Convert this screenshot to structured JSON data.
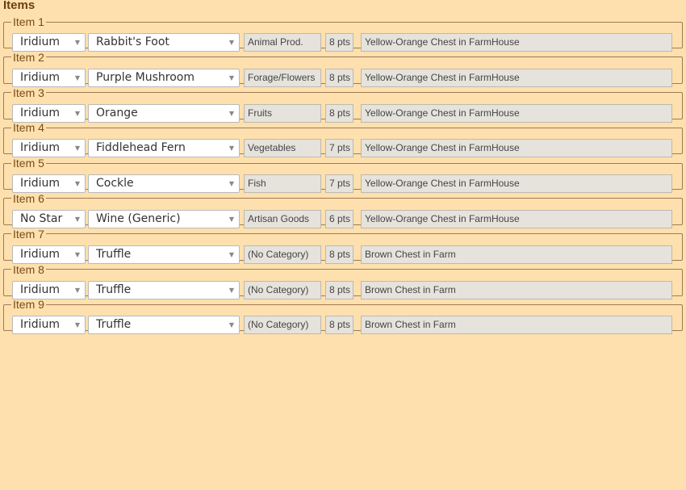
{
  "heading": "Items",
  "items": [
    {
      "label": "Item 1",
      "quality": "Iridium",
      "name": "Rabbit's Foot",
      "category": "Animal Prod.",
      "points": "8 pts",
      "location": "Yellow-Orange Chest in FarmHouse"
    },
    {
      "label": "Item 2",
      "quality": "Iridium",
      "name": "Purple Mushroom",
      "category": "Forage/Flowers",
      "points": "8 pts",
      "location": "Yellow-Orange Chest in FarmHouse"
    },
    {
      "label": "Item 3",
      "quality": "Iridium",
      "name": "Orange",
      "category": "Fruits",
      "points": "8 pts",
      "location": "Yellow-Orange Chest in FarmHouse"
    },
    {
      "label": "Item 4",
      "quality": "Iridium",
      "name": "Fiddlehead Fern",
      "category": "Vegetables",
      "points": "7 pts",
      "location": "Yellow-Orange Chest in FarmHouse"
    },
    {
      "label": "Item 5",
      "quality": "Iridium",
      "name": "Cockle",
      "category": "Fish",
      "points": "7 pts",
      "location": "Yellow-Orange Chest in FarmHouse"
    },
    {
      "label": "Item 6",
      "quality": "No Star",
      "name": "Wine (Generic)",
      "category": "Artisan Goods",
      "points": "6 pts",
      "location": "Yellow-Orange Chest in FarmHouse"
    },
    {
      "label": "Item 7",
      "quality": "Iridium",
      "name": "Truffle",
      "category": "(No Category)",
      "points": "8 pts",
      "location": "Brown Chest in Farm"
    },
    {
      "label": "Item 8",
      "quality": "Iridium",
      "name": "Truffle",
      "category": "(No Category)",
      "points": "8 pts",
      "location": "Brown Chest in Farm"
    },
    {
      "label": "Item 9",
      "quality": "Iridium",
      "name": "Truffle",
      "category": "(No Category)",
      "points": "8 pts",
      "location": "Brown Chest in Farm"
    }
  ],
  "dropdown_arrow_icon": "chevron-down-icon"
}
